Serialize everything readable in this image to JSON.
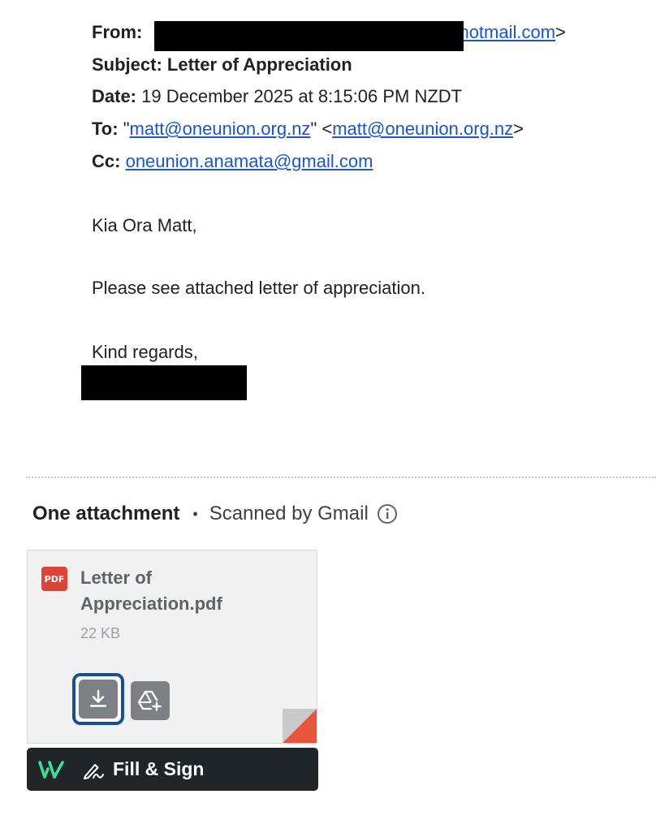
{
  "header": {
    "from_label": "From:",
    "from_domain": "hotmail.com",
    "from_close": ">",
    "subject_label": "Subject:",
    "subject_value": "Letter of Appreciation",
    "date_label": "Date:",
    "date_value": "19 December 2025 at 8:15:06 PM NZDT",
    "to_label": "To:",
    "to_quote_open": "\"",
    "to_name_link": "matt@oneunion.org.nz",
    "to_quote_close": "\"",
    "to_open": "<",
    "to_email_link": "matt@oneunion.org.nz",
    "to_close": ">",
    "cc_label": "Cc:",
    "cc_value": "oneunion.anamata@gmail.com"
  },
  "body": {
    "greeting": "Kia Ora Matt,",
    "message": "Please see attached letter of appreciation.",
    "signoff": "Kind regards,"
  },
  "attachments": {
    "title": "One attachment",
    "separator": "•",
    "scanned_text": "Scanned by Gmail",
    "info_icon": "info-icon",
    "file": {
      "badge": "PDF",
      "name": "Letter of Appreciation.pdf",
      "size": "22 KB",
      "download_icon": "download-icon",
      "drive_icon": "add-to-drive-icon"
    }
  },
  "fill_sign": {
    "label": "Fill & Sign",
    "logo_icon": "fill-sign-logo-icon",
    "pen_icon": "signature-pen-icon"
  },
  "colors": {
    "link": "#1a56c4",
    "pdf_badge": "#db4437",
    "focus_ring": "#1a4f8f",
    "fill_sign_bg": "#1f2528",
    "fill_sign_accent": "#3ddc97",
    "fold_accent": "#e8553a"
  }
}
